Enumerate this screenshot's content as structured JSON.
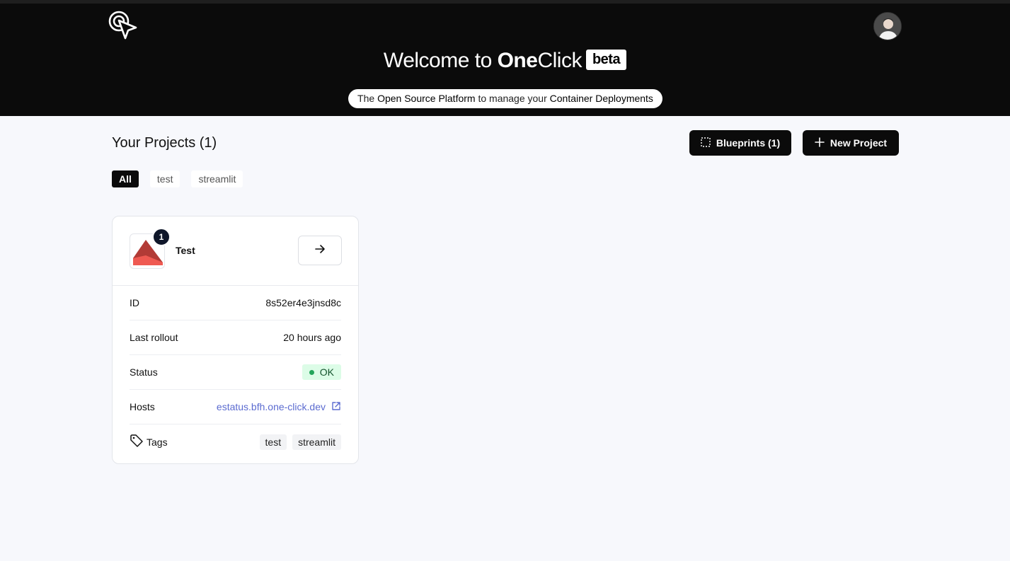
{
  "header": {
    "welcome_prefix": "Welcome to ",
    "brand_bold": "One",
    "brand_rest": "Click",
    "beta_label": "beta",
    "tagline": {
      "part1": "The ",
      "highlight1": "Open Source Platform",
      "part2": " to manage your ",
      "highlight2": "Container Deployments"
    }
  },
  "projects": {
    "title": "Your Projects (1)",
    "blueprints_label": "Blueprints (1)",
    "new_project_label": "New Project",
    "filters": [
      "All",
      "test",
      "streamlit"
    ],
    "active_filter": "All"
  },
  "card": {
    "name": "Test",
    "badge_count": "1",
    "rows": {
      "id_label": "ID",
      "id_value": "8s52er4e3jnsd8c",
      "rollout_label": "Last rollout",
      "rollout_value": "20 hours ago",
      "status_label": "Status",
      "status_value": "OK",
      "hosts_label": "Hosts",
      "hosts_value": "estatus.bfh.one-click.dev",
      "tags_label": "Tags",
      "tags": [
        "test",
        "streamlit"
      ]
    }
  },
  "colors": {
    "header_bg": "#0b0b0b",
    "page_bg": "#f7f8fc",
    "link": "#5b6bd0",
    "status_ok_bg": "#dcfce7",
    "status_dot": "#22a55a"
  },
  "icons": {
    "logo": "cursor-click-icon",
    "blueprints": "dashed-square-icon",
    "new_project": "plus-icon",
    "open": "arrow-right-icon",
    "external": "external-link-icon",
    "tags": "tag-icon"
  }
}
